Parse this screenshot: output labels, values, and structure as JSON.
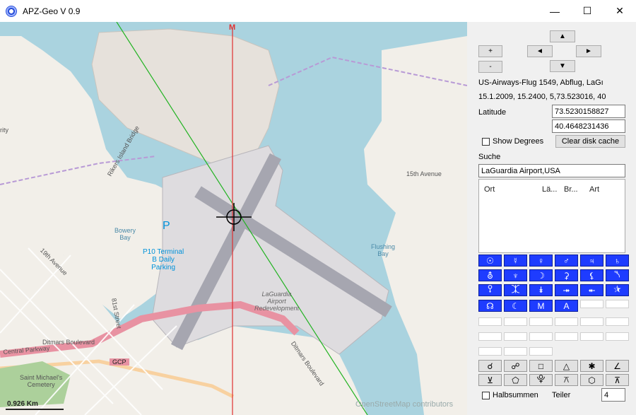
{
  "window": {
    "title": "APZ-Geo V 0.9",
    "minimize": "—",
    "maximize": "☐",
    "close": "✕"
  },
  "map": {
    "meridian_label": "M",
    "labels": {
      "bowery_bay": "Bowery\nBay",
      "p10": "P10 Terminal\nB Daily\nParking",
      "parking_p": "P",
      "laguardia": "LaGuardia\nAirport\nRedevelopment",
      "flushing_bay": "Flushing\nBay",
      "rikers_bridge": "Rikers Island Bridge",
      "nineteenth_ave": "19th Avenue",
      "eightyfirst": "81st Street",
      "ditmars_blvd": "Ditmars Boulevard",
      "ditmars_blvd2": "Ditmars Boulevard",
      "central_pkwy": "Central Parkway",
      "saint_michaels": "Saint Michael's\nCemetery",
      "gcp": "GCP",
      "fifteenth_ave": "15th Avenue",
      "rity": "rity"
    },
    "scale": "0.926 Km",
    "attribution": "OpenStreetMap contributors"
  },
  "panel": {
    "zoom_in": "+",
    "zoom_out": "-",
    "pan_up": "▲",
    "pan_left": "◄",
    "pan_right": "►",
    "pan_down": "▼",
    "event_title": "US-Airways-Flug 1549, Abflug, LaGı",
    "event_data": "15.1.2009, 15.2400, 5,73.523016, 40",
    "latitude_label": "Latitude",
    "lat_value": "73.5230158827",
    "lon_value": "40.4648231436",
    "show_degrees": "Show Degrees",
    "clear_cache": "Clear disk cache",
    "search_label": "Suche",
    "search_value": "LaGuardia Airport,USA",
    "table_headers": [
      "Ort",
      "Lä...",
      "Br...",
      "Art"
    ],
    "planet_rows": [
      [
        "☉",
        "☿",
        "♀",
        "♂",
        "♃",
        "♄"
      ],
      [
        "⛢",
        "♆",
        "☽",
        "⚳",
        "⚸",
        "⯲"
      ],
      [
        "⯱",
        "⯰",
        "⯯",
        "⯮",
        "⯬",
        "⯫"
      ],
      [
        "☊",
        "☾",
        "M",
        "A"
      ]
    ],
    "aspect_rows": [
      [
        "☌",
        "☍",
        "□",
        "△",
        "✱",
        "∠"
      ],
      [
        "⊻",
        "⬠",
        "⯓",
        "⚻",
        "⬡",
        "⊼"
      ]
    ],
    "halbsummen": "Halbsummen",
    "teiler_label": "Teiler",
    "teiler_value": "4"
  }
}
